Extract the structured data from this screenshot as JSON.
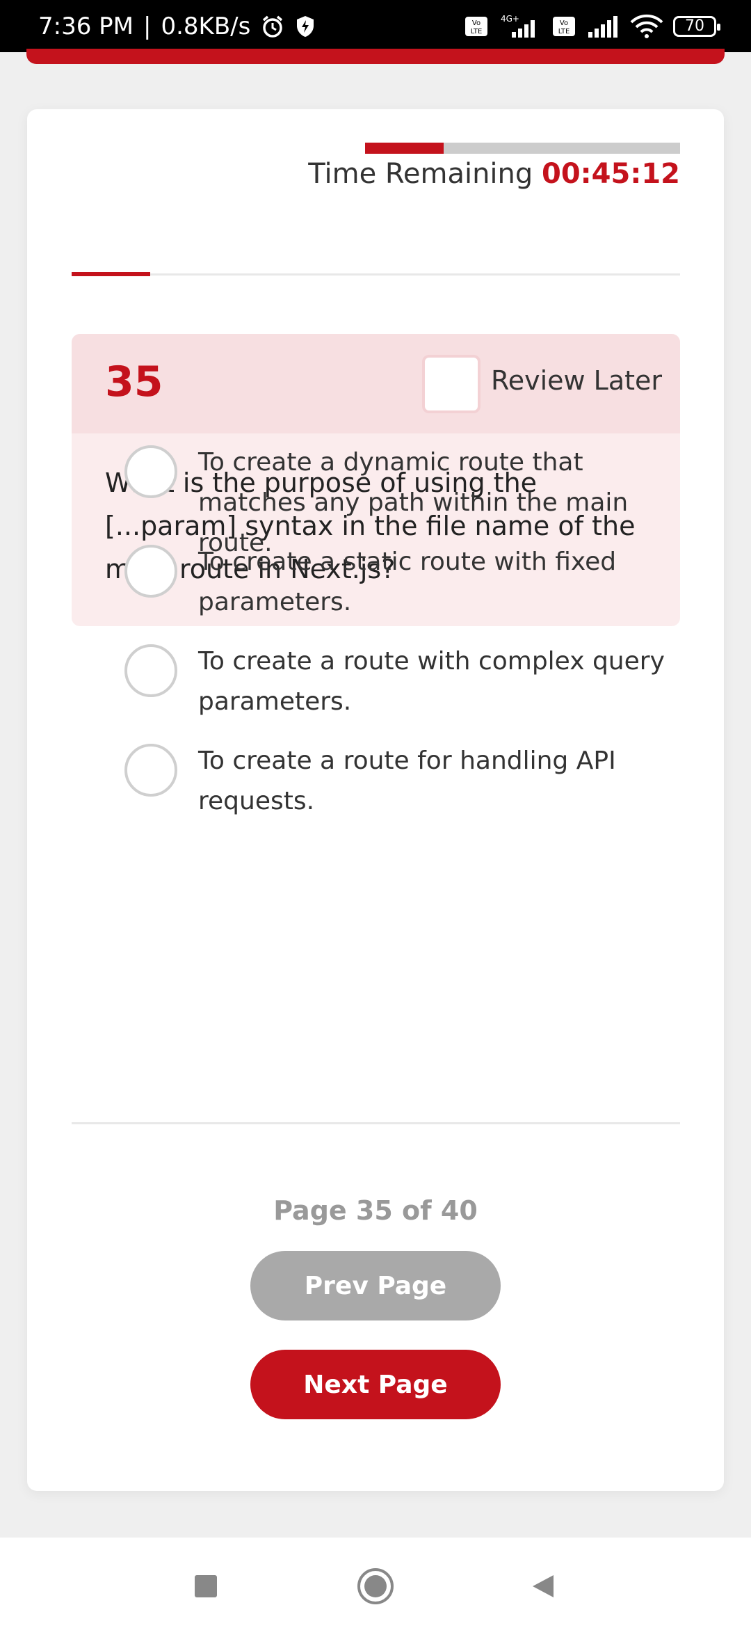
{
  "status_bar": {
    "time": "7:36 PM",
    "separator": "|",
    "speed": "0.8KB/s",
    "network_type": "4G+",
    "battery": "70"
  },
  "timer": {
    "label": "Time Remaining",
    "value": "00:45:12",
    "progress_fraction": 0.25
  },
  "question": {
    "number": "35",
    "review_label": "Review Later",
    "review_checked": false,
    "text": "What is the purpose of using the [...param] syntax in the file name of the main route in Next.js?"
  },
  "options": [
    {
      "text": "To create a dynamic route that matches any path within the main route."
    },
    {
      "text": "To create a static route with fixed parameters."
    },
    {
      "text": "To create a route with complex query parameters."
    },
    {
      "text": "To create a route for handling API requests."
    }
  ],
  "pagination": {
    "indicator": "Page 35 of 40",
    "prev_label": "Prev Page",
    "next_label": "Next Page"
  },
  "colors": {
    "accent": "#c4121c",
    "disabled_button": "#a9a9a9"
  },
  "icons": {
    "alarm": "alarm-icon",
    "shield": "shield-icon",
    "signal": "signal-icon",
    "wifi": "wifi-icon",
    "battery": "battery-icon",
    "nav_recents": "square-icon",
    "nav_home": "circle-icon",
    "nav_back": "triangle-back-icon"
  }
}
